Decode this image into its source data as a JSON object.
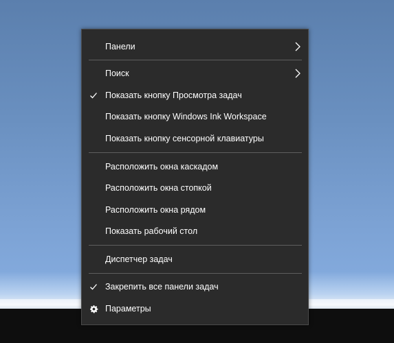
{
  "menu": {
    "items": [
      {
        "label": "Панели",
        "icon": "chevron-right-icon"
      },
      {
        "label": "Поиск",
        "icon": "chevron-right-icon"
      },
      {
        "label": "Показать кнопку Просмотра задач",
        "icon": "checkmark-icon",
        "checked": true
      },
      {
        "label": "Показать кнопку Windows Ink Workspace"
      },
      {
        "label": "Показать кнопку сенсорной клавиатуры"
      },
      {
        "label": "Расположить окна каскадом"
      },
      {
        "label": "Расположить окна стопкой"
      },
      {
        "label": "Расположить окна рядом"
      },
      {
        "label": "Показать рабочий стол"
      },
      {
        "label": "Диспетчер задач"
      },
      {
        "label": "Закрепить все панели задач",
        "icon": "checkmark-icon",
        "checked": true
      },
      {
        "label": "Параметры",
        "icon": "gear-icon"
      }
    ]
  },
  "colors": {
    "menu_background": "#2b2b2b",
    "menu_text": "#ffffff",
    "separator": "#5f5f5f",
    "taskbar": "#0e0e0e",
    "desktop": "#6a90c0"
  }
}
